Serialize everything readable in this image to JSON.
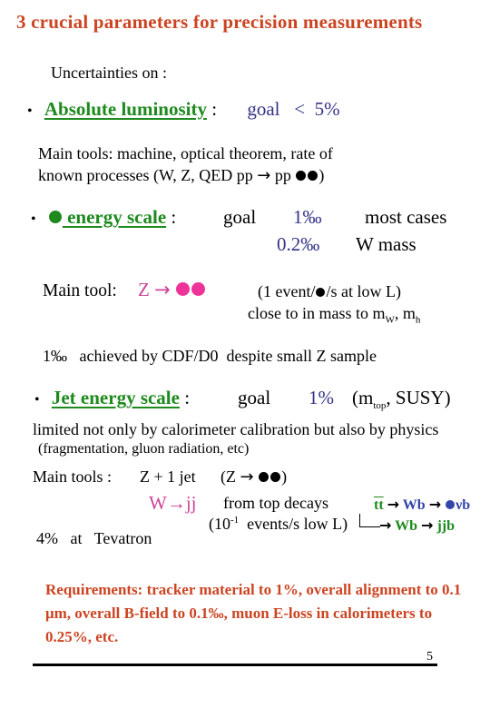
{
  "title": "3 crucial parameters for precision measurements",
  "intro": "Uncertainties on :",
  "bullet_glyph": "•",
  "arrow": "→",
  "luminosity": {
    "label": "Absolute luminosity",
    "colon": ":",
    "goal": "goal   <  5%",
    "tools_line1": "Main tools:  machine, optical theorem,  rate of",
    "tools_line2_a": "known processes (W, Z, QED pp ",
    "tools_line2_b": " pp ",
    "tools_line2_c": ")"
  },
  "lepton_energy": {
    "label": "energy scale",
    "colon": ":",
    "goal": "goal",
    "value1": "1‰",
    "case1": "most cases",
    "value2": "0.2‰",
    "case2": "W mass",
    "tool_label": "Main tool:",
    "tool_process": "Z ",
    "rate_a": "(1 event/",
    "rate_b": "/s at low L)",
    "close_a": "close to in mass to m",
    "close_sub1": "W",
    "close_b": ", m",
    "close_sub2": "h",
    "achieved": "1‰   achieved by CDF/D0  despite small Z sample"
  },
  "jet_energy": {
    "label": "Jet energy scale",
    "colon": ":",
    "goal": "goal",
    "value": "1%",
    "paren_a": "(m",
    "paren_sub": "top",
    "paren_b": ", SUSY)",
    "limited": "limited not only by calorimeter calibration but also by physics",
    "limited_note": "(fragmentation, gluon radiation, etc)",
    "tools_label": "Main tools :",
    "tool1": "Z + 1 jet",
    "tool1_paren_a": "(Z ",
    "tool1_paren_b": ")",
    "tool2": "W→jj",
    "tool2_desc": "from top decays",
    "rate_a": "(10",
    "rate_sup": "-1",
    "rate_b": "  events/s low L)",
    "tevatron": "4%   at   Tevatron",
    "decay_tt": "tt",
    "decay_wb1": "Wb",
    "decay_end1": "νb",
    "decay_wb2": "Wb",
    "decay_end2": "jjb"
  },
  "requirements": "Requirements: tracker material to 1%, overall alignment to 0.1 μm,  overall B-field to 0.1‰, muon  E-loss in calorimeters to 0.25%, etc.",
  "page_number": "5",
  "colors": {
    "title": "#cc4422",
    "heading_green": "#1e8a1e",
    "value_blue": "#333388",
    "process_pink": "#cc4499"
  }
}
